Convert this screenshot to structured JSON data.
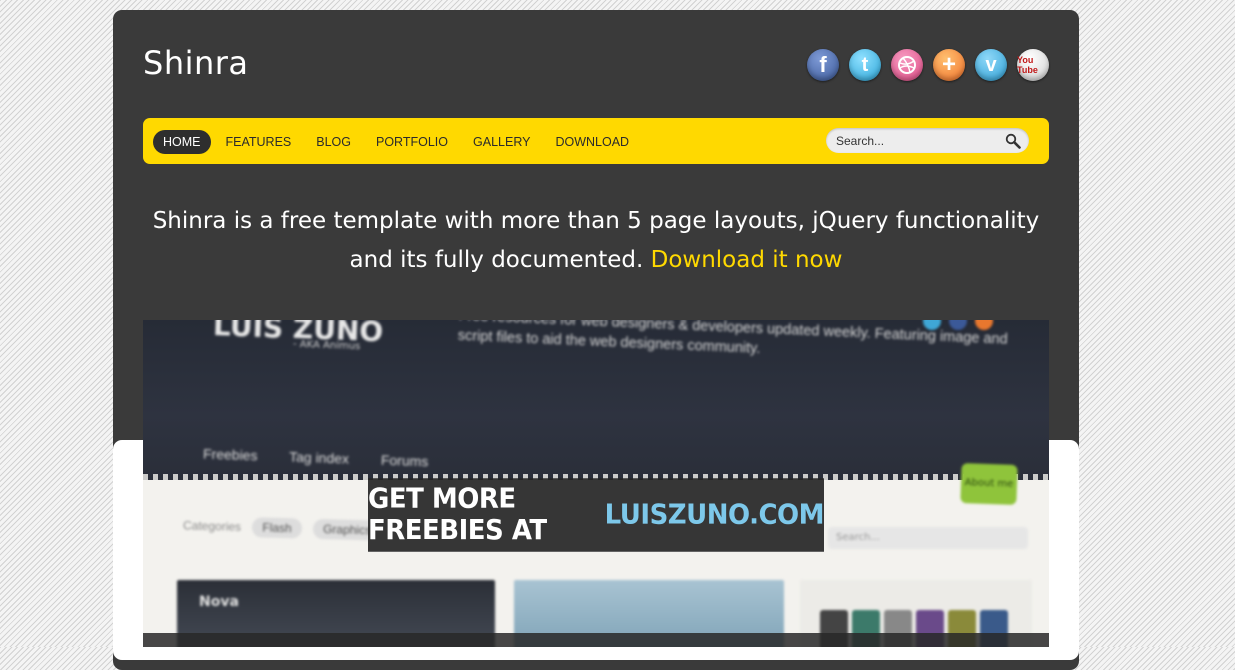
{
  "site": {
    "logo": "Shinra"
  },
  "social": [
    {
      "name": "facebook-icon",
      "glyph": "f"
    },
    {
      "name": "twitter-icon",
      "glyph": "t"
    },
    {
      "name": "dribbble-icon",
      "glyph": "◎"
    },
    {
      "name": "plus-icon",
      "glyph": "+"
    },
    {
      "name": "vimeo-icon",
      "glyph": "v"
    },
    {
      "name": "youtube-icon",
      "glyph": "You Tube"
    }
  ],
  "nav": {
    "items": [
      "HOME",
      "FEATURES",
      "BLOG",
      "PORTFOLIO",
      "GALLERY",
      "DOWNLOAD"
    ],
    "active": "HOME"
  },
  "search": {
    "placeholder": "Search..."
  },
  "tagline": {
    "text": "Shinra is a free template with more than 5 page layouts, jQuery functionality and its fully documented. ",
    "link": "Download it now"
  },
  "slider": {
    "caption_main": "GET MORE FREEBIES AT",
    "caption_link": "LUISZUNO.COM",
    "shot": {
      "logo": "LUIS ZUNO",
      "aka": "- AKA Animus",
      "description": "Free resources for web designers & developers updated weekly. Featuring image and script files to aid the web designers community.",
      "nav": [
        "Freebies",
        "Tag index",
        "Forums"
      ],
      "button": "About me",
      "categories_label": "Categories",
      "categories": [
        "Flash",
        "Graphics"
      ],
      "search_placeholder": "Search...",
      "thumb_title": "Nova"
    }
  },
  "colors": {
    "accent": "#ffd900",
    "panel": "#3a3a3a",
    "link_blue": "#7dc8ea"
  }
}
